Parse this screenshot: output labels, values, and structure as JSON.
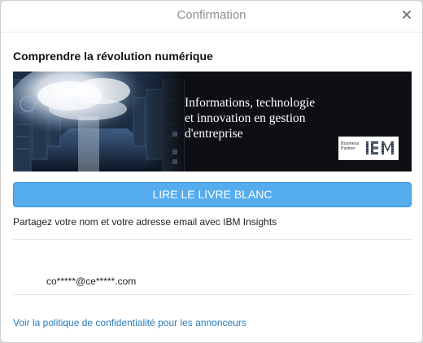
{
  "dialog": {
    "title": "Confirmation",
    "close_icon": "close-icon"
  },
  "card": {
    "heading": "Comprendre la révolution numérique",
    "banner": {
      "text_line1": "Informations, technologie",
      "text_line2": "et innovation en gestion",
      "text_line3": "d'entreprise",
      "partner_label": "Business\nPartner",
      "logo_text": "IBM"
    },
    "cta_label": "LIRE LE LIVRE BLANC",
    "share_text": "Partagez votre nom et votre adresse email avec IBM Insights",
    "email": "co*****@ce*****.com",
    "privacy_link": "Voir la politique de confidentialité pour les annonceurs"
  },
  "colors": {
    "cta": "#55acee",
    "link": "#2b7bb9",
    "title": "#8f8f8f"
  }
}
